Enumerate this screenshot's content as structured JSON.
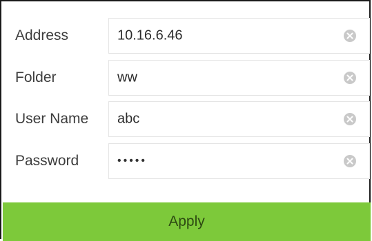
{
  "form": {
    "rows": [
      {
        "label": "Address",
        "value": "10.16.6.46",
        "clear_icon": "clear-circle-x-icon"
      },
      {
        "label": "Folder",
        "value": "ww",
        "clear_icon": "clear-circle-x-icon"
      },
      {
        "label": "User Name",
        "value": "abc",
        "clear_icon": "clear-circle-x-icon"
      },
      {
        "label": "Password",
        "value": "•••••",
        "clear_icon": "clear-circle-x-icon"
      }
    ]
  },
  "apply_button": {
    "label": "Apply",
    "color": "#7dc93a"
  }
}
